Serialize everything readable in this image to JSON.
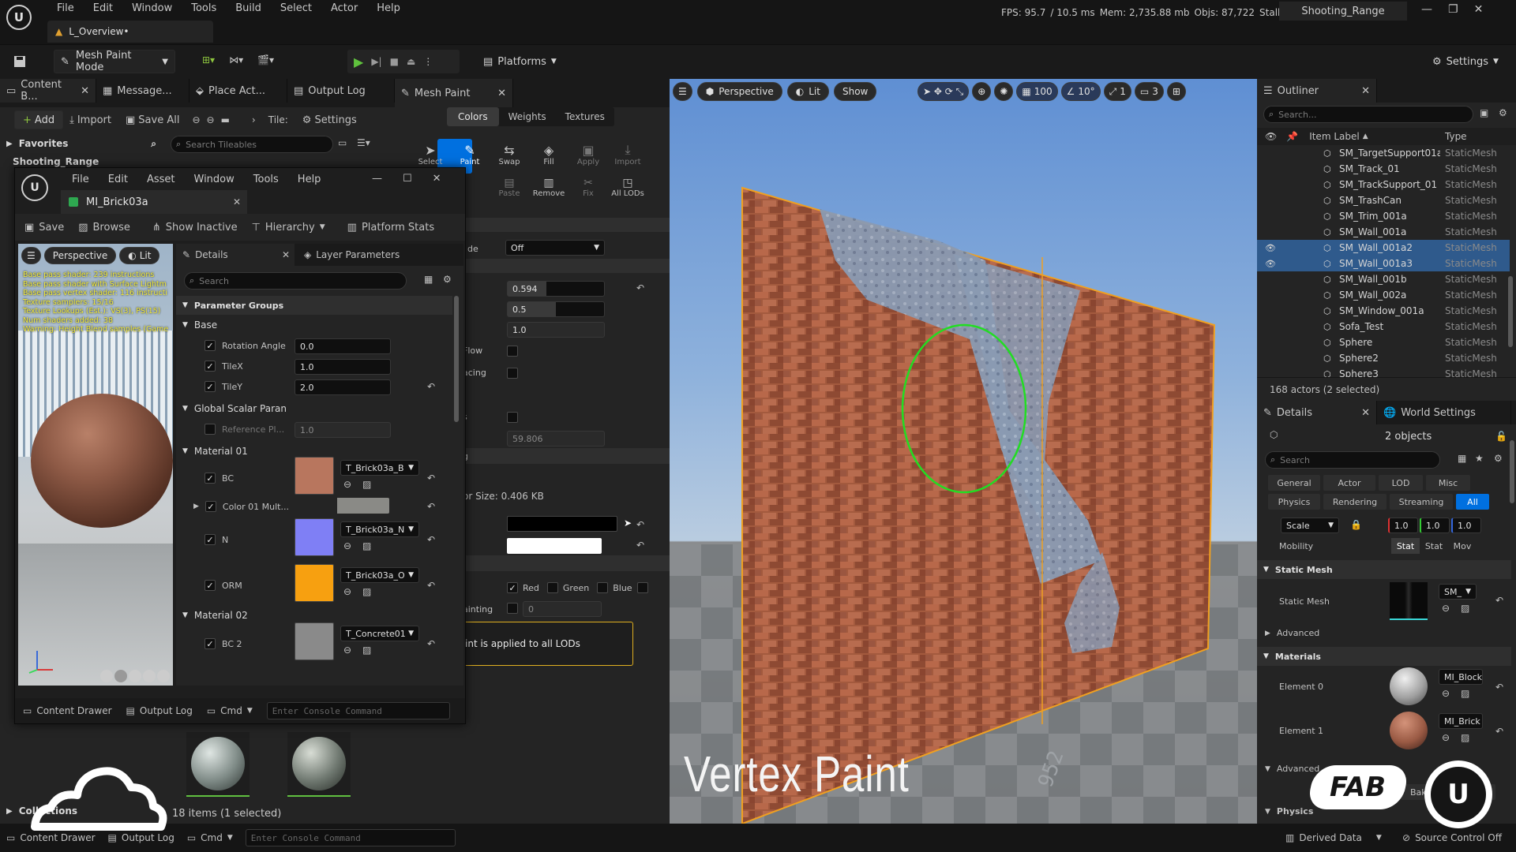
{
  "menu": [
    "File",
    "Edit",
    "Window",
    "Tools",
    "Build",
    "Select",
    "Actor",
    "Help"
  ],
  "level_tab": "L_Overview•",
  "stats": {
    "fps": "FPS: 95.7",
    "ms": "/ 10.5 ms",
    "mem": "Mem: 2,735.88 mb",
    "objs": "Objs: 87,722",
    "stalls": "Stalls: 0"
  },
  "project_name": "Shooting_Range",
  "toolbar": {
    "mode": "Mesh Paint Mode",
    "platforms": "Platforms",
    "settings": "Settings"
  },
  "left_tabs": [
    "Content B...",
    "Message...",
    "Place Act...",
    "Output Log"
  ],
  "content_browser": {
    "add": "Add",
    "import": "Import",
    "save_all": "Save All",
    "path_tail": "Tile:",
    "settings": "Settings",
    "favorites": "Favorites",
    "search_placeholder": "Search Tileables",
    "collections": "Collections",
    "items_status": "18 items (1 selected)",
    "truncated_folder": "Shooting_Range"
  },
  "mesh_paint": {
    "tab": "Mesh Paint",
    "subtabs": [
      "Colors",
      "Weights",
      "Textures"
    ],
    "tools": [
      "Select",
      "Paint",
      "Swap",
      "Fill",
      "Apply",
      "Import"
    ],
    "tools2": [
      "Paste",
      "Remove",
      "Fix",
      "All LODs"
    ],
    "rows": {
      "mode_suffix": "de",
      "mode_value": "Off",
      "v1": "0.594",
      "v2": "0.5",
      "v3": "1.0",
      "flow": "Flow",
      "facing": "acing",
      "s": "s",
      "v4": "59.806",
      "g": "g",
      "color_size": "or Size: 0.406 KB",
      "red": "Red",
      "green": "Green",
      "blue": "Blue",
      "painting": "ainting",
      "paint_val": "0",
      "note": "int is applied to all LODs"
    }
  },
  "material_editor": {
    "menu": [
      "File",
      "Edit",
      "Asset",
      "Window",
      "Tools",
      "Help"
    ],
    "tab": "MI_Brick03a",
    "save": "Save",
    "browse": "Browse",
    "show_inactive": "Show Inactive",
    "hierarchy": "Hierarchy",
    "platform_stats": "Platform Stats",
    "viewport": {
      "perspective": "Perspective",
      "lit": "Lit"
    },
    "stats_lines": [
      "Base pass shader: 239 instructions",
      "Base pass shader with Surface Lightm",
      "Base pass vertex shader: 116 instructi",
      "Texture samplers: 15/16",
      "Texture Lookups (Est.): VS(3), PS(15)",
      "Num shaders added: 38",
      "Warning: Height Blend samples (Game"
    ],
    "details_tab": "Details",
    "layer_tab": "Layer Parameters",
    "search": "Search",
    "groups_header": "Parameter Groups",
    "base": "Base",
    "rotation_angle": "Rotation Angle",
    "rotation_val": "0.0",
    "tilex": "TileX",
    "tilex_val": "1.0",
    "tiley": "TileY",
    "tiley_val": "2.0",
    "global_scalar": "Global Scalar Paran",
    "reference": "Reference Pl...",
    "reference_val": "1.0",
    "material01": "Material 01",
    "bc": "BC",
    "bc_tex": "T_Brick03a_B",
    "color_mult": "Color 01 Mult...",
    "n": "N",
    "n_tex": "T_Brick03a_N",
    "orm": "ORM",
    "orm_tex": "T_Brick03a_O",
    "material02": "Material 02",
    "bc2": "BC 2",
    "bc2_tex": "T_Concrete01",
    "content_drawer": "Content Drawer",
    "output_log": "Output Log",
    "cmd": "Cmd",
    "console": "Enter Console Command"
  },
  "viewport": {
    "perspective": "Perspective",
    "lit": "Lit",
    "show": "Show",
    "grid": "100",
    "angle": "10°",
    "scale": "1",
    "cam": "3",
    "title": "Vertex Paint",
    "floor_number": "952"
  },
  "outliner": {
    "tab": "Outliner",
    "search": "Search...",
    "col_label": "Item Label",
    "col_type": "Type",
    "rows": [
      {
        "name": "SM_TargetSupport01a",
        "type": "StaticMesh",
        "sel": false
      },
      {
        "name": "SM_Track_01",
        "type": "StaticMesh",
        "sel": false
      },
      {
        "name": "SM_TrackSupport_01",
        "type": "StaticMesh",
        "sel": false
      },
      {
        "name": "SM_TrashCan",
        "type": "StaticMesh",
        "sel": false
      },
      {
        "name": "SM_Trim_001a",
        "type": "StaticMesh",
        "sel": false
      },
      {
        "name": "SM_Wall_001a",
        "type": "StaticMesh",
        "sel": false
      },
      {
        "name": "SM_Wall_001a2",
        "type": "StaticMesh",
        "sel": true
      },
      {
        "name": "SM_Wall_001a3",
        "type": "StaticMesh",
        "sel": true
      },
      {
        "name": "SM_Wall_001b",
        "type": "StaticMesh",
        "sel": false
      },
      {
        "name": "SM_Wall_002a",
        "type": "StaticMesh",
        "sel": false
      },
      {
        "name": "SM_Window_001a",
        "type": "StaticMesh",
        "sel": false
      },
      {
        "name": "Sofa_Test",
        "type": "StaticMesh",
        "sel": false
      },
      {
        "name": "Sphere",
        "type": "StaticMesh",
        "sel": false
      },
      {
        "name": "Sphere2",
        "type": "StaticMesh",
        "sel": false
      },
      {
        "name": "Sphere3",
        "type": "StaticMesh",
        "sel": false
      }
    ],
    "status": "168 actors (2 selected)"
  },
  "details": {
    "tab": "Details",
    "world_settings": "World Settings",
    "objects": "2 objects",
    "search": "Search",
    "filters1": [
      "General",
      "Actor",
      "LOD",
      "Misc"
    ],
    "filters2": [
      "Physics",
      "Rendering",
      "Streaming",
      "All"
    ],
    "scale": "Scale",
    "sx": "1.0",
    "sy": "1.0",
    "sz": "1.0",
    "mobility": "Mobility",
    "mob": [
      "Stat",
      "Stat",
      "Mov"
    ],
    "static_mesh_section": "Static Mesh",
    "static_mesh": "Static Mesh",
    "sm_val": "SM_",
    "advanced": "Advanced",
    "materials": "Materials",
    "element0": "Element 0",
    "el0_val": "MI_Block",
    "element1": "Element 1",
    "el1_val": "MI_Brick",
    "advanced2": "Advanced",
    "bake": "Bake",
    "physics": "Physics"
  },
  "statusbar": {
    "content_drawer": "Content Drawer",
    "output_log": "Output Log",
    "cmd": "Cmd",
    "console": "Enter Console Command",
    "derived": "Derived Data",
    "source": "Source Control Off"
  },
  "logos": {
    "fab": "FAB"
  },
  "colors": {
    "accent_blue": "#0070e0",
    "selection": "#2f5a8c",
    "brush_ring": "#22dd22",
    "wall_outline": "#f0a020"
  }
}
